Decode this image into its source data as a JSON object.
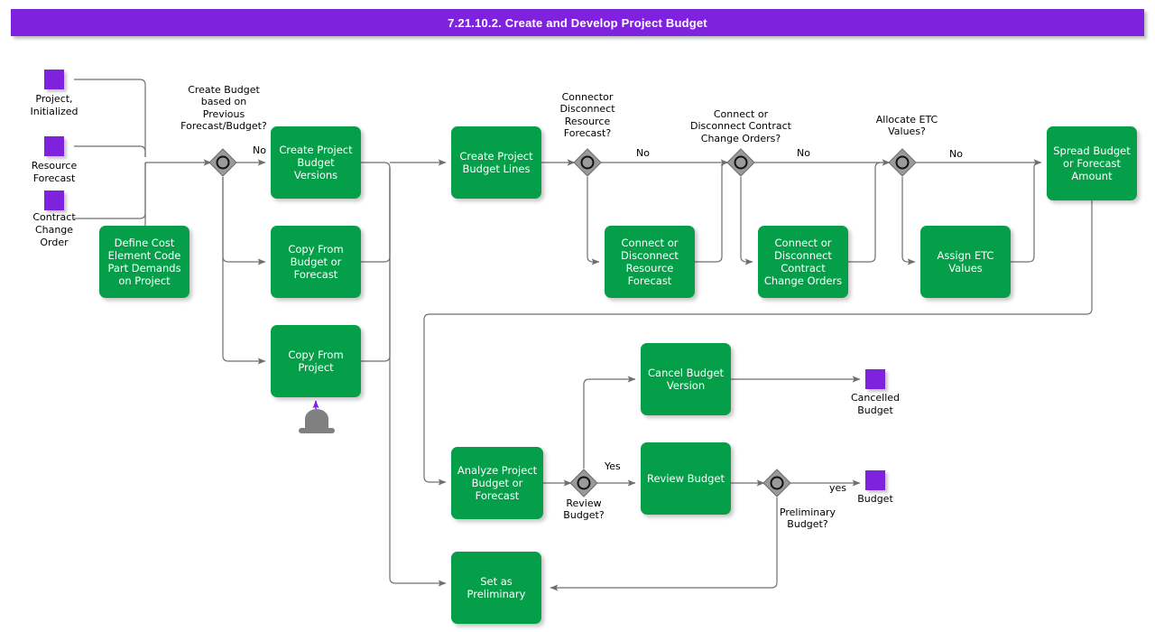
{
  "header": {
    "title": "7.21.10.2. Create and Develop Project Budget"
  },
  "colors": {
    "accent_purple": "#7F22DD",
    "task_green": "#059F4A",
    "gateway_grey": "#808080",
    "line": "#707070"
  },
  "start_events": [
    {
      "id": "project-initialized",
      "label": "Project,\nInitialized"
    },
    {
      "id": "resource-forecast",
      "label": "Resource\nForecast"
    },
    {
      "id": "contract-change-order",
      "label": "Contract\nChange\nOrder"
    }
  ],
  "end_events": [
    {
      "id": "cancelled-budget",
      "label": "Cancelled\nBudget"
    },
    {
      "id": "budget",
      "label": "Budget"
    }
  ],
  "tasks": [
    {
      "id": "define-cost-element",
      "label": "Define Cost\nElement Code\nPart Demands\non Project"
    },
    {
      "id": "create-project-budget-versions",
      "label": "Create Project\nBudget Versions"
    },
    {
      "id": "copy-from-budget-or-forecast",
      "label": "Copy From\nBudget or\nForecast"
    },
    {
      "id": "copy-from-project",
      "label": "Copy From\nProject"
    },
    {
      "id": "create-project-budget-lines",
      "label": "Create Project\nBudget Lines"
    },
    {
      "id": "connect-disconnect-resource-forecast",
      "label": "Connect or\nDisconnect\nResource\nForecast"
    },
    {
      "id": "connect-disconnect-contract-change-orders",
      "label": "Connect or\nDisconnect\nContract\nChange Orders"
    },
    {
      "id": "assign-etc-values",
      "label": "Assign ETC\nValues"
    },
    {
      "id": "spread-budget-or-forecast-amount",
      "label": "Spread Budget\nor Forecast\nAmount"
    },
    {
      "id": "cancel-budget-version",
      "label": "Cancel Budget\nVersion"
    },
    {
      "id": "analyze-project-budget-or-forecast",
      "label": "Analyze Project\nBudget or\nForecast"
    },
    {
      "id": "review-budget",
      "label": "Review Budget"
    },
    {
      "id": "set-as-preliminary",
      "label": "Set as\nPreliminary"
    }
  ],
  "gateways": [
    {
      "id": "create-budget-based-on-previous",
      "label": "Create Budget\nbased on\nPrevious\nForecast/Budget?"
    },
    {
      "id": "connector-disconnect-resource-forecast",
      "label": "Connector\nDisconnect\nResource\nForecast?"
    },
    {
      "id": "connect-or-disconnect-contract-change-orders",
      "label": "Connect or\nDisconnect Contract\nChange Orders?"
    },
    {
      "id": "allocate-etc-values",
      "label": "Allocate ETC\nValues?"
    },
    {
      "id": "review-budget-gw",
      "label": "Review\nBudget?"
    },
    {
      "id": "preliminary-budget-gw",
      "label": "Preliminary\nBudget?"
    }
  ],
  "flow_labels": [
    {
      "id": "no-1",
      "text": "No"
    },
    {
      "id": "no-2",
      "text": "No"
    },
    {
      "id": "no-3",
      "text": "No"
    },
    {
      "id": "no-4",
      "text": "No"
    },
    {
      "id": "yes-1",
      "text": "Yes"
    },
    {
      "id": "yes-2",
      "text": "yes"
    }
  ],
  "data_store": {
    "id": "copy-source-data-store",
    "label": ""
  }
}
